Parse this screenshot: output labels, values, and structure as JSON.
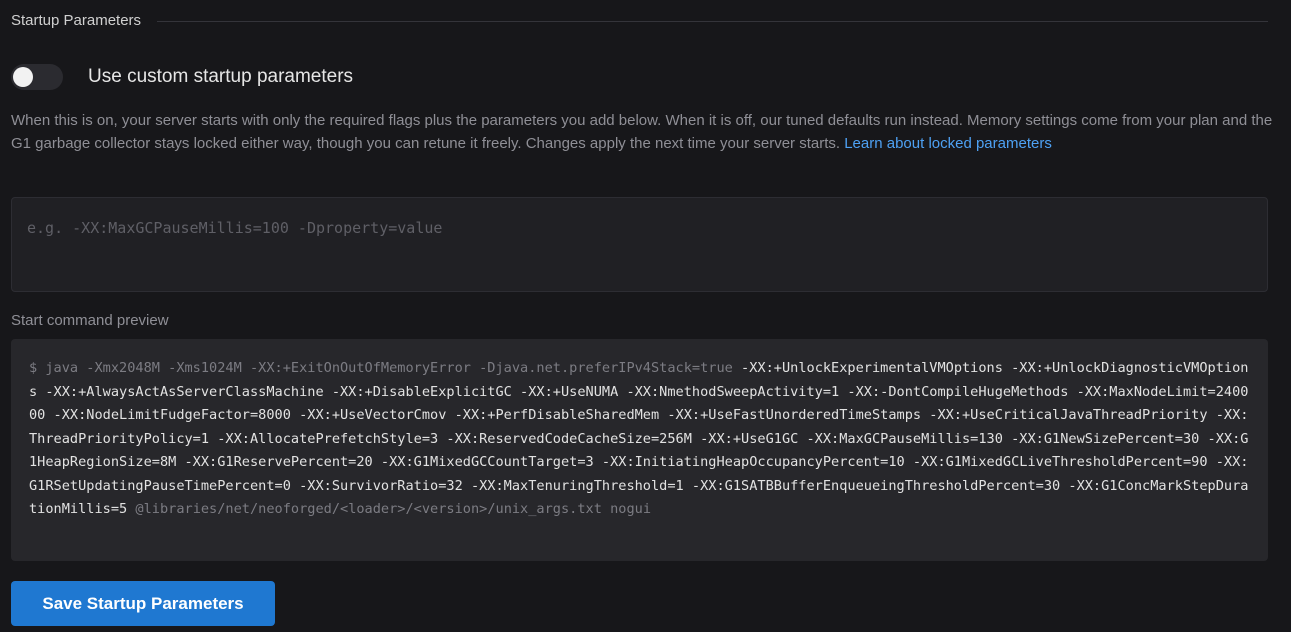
{
  "section": {
    "title": "Startup Parameters"
  },
  "toggle": {
    "label": "Use custom startup parameters",
    "state": "off"
  },
  "description": {
    "text": "When this is on, your server starts with only the required flags plus the parameters you add below. When it is off, our tuned defaults run instead. Memory settings come from your plan and the G1 garbage collector stays locked either way, though you can retune it freely. Changes apply the next time your server starts. ",
    "link_label": "Learn about locked parameters"
  },
  "params_input": {
    "value": "",
    "placeholder": "e.g. -XX:MaxGCPauseMillis=100 -Dproperty=value"
  },
  "preview": {
    "label": "Start command preview",
    "prefix": "$ java -Xmx2048M -Xms1024M -XX:+ExitOnOutOfMemoryError -Djava.net.preferIPv4Stack=true ",
    "custom": "-XX:+UnlockExperimentalVMOptions -XX:+UnlockDiagnosticVMOptions -XX:+AlwaysActAsServerClassMachine -XX:+DisableExplicitGC -XX:+UseNUMA -XX:NmethodSweepActivity=1 -XX:-DontCompileHugeMethods -XX:MaxNodeLimit=240000 -XX:NodeLimitFudgeFactor=8000 -XX:+UseVectorCmov -XX:+PerfDisableSharedMem -XX:+UseFastUnorderedTimeStamps -XX:+UseCriticalJavaThreadPriority -XX:ThreadPriorityPolicy=1 -XX:AllocatePrefetchStyle=3 -XX:ReservedCodeCacheSize=256M -XX:+UseG1GC -XX:MaxGCPauseMillis=130 -XX:G1NewSizePercent=30 -XX:G1HeapRegionSize=8M -XX:G1ReservePercent=20 -XX:G1MixedGCCountTarget=3 -XX:InitiatingHeapOccupancyPercent=10 -XX:G1MixedGCLiveThresholdPercent=90 -XX:G1RSetUpdatingPauseTimePercent=0 -XX:SurvivorRatio=32 -XX:MaxTenuringThreshold=1 -XX:G1SATBBufferEnqueueingThresholdPercent=30 -XX:G1ConcMarkStepDurationMillis=5",
    "suffix": " @libraries/net/neoforged/<loader>/<version>/unix_args.txt nogui"
  },
  "save_button": {
    "label": "Save Startup Parameters"
  },
  "colors": {
    "accent": "#1f78d1",
    "link": "#4ea1f3",
    "background": "#17171a"
  }
}
